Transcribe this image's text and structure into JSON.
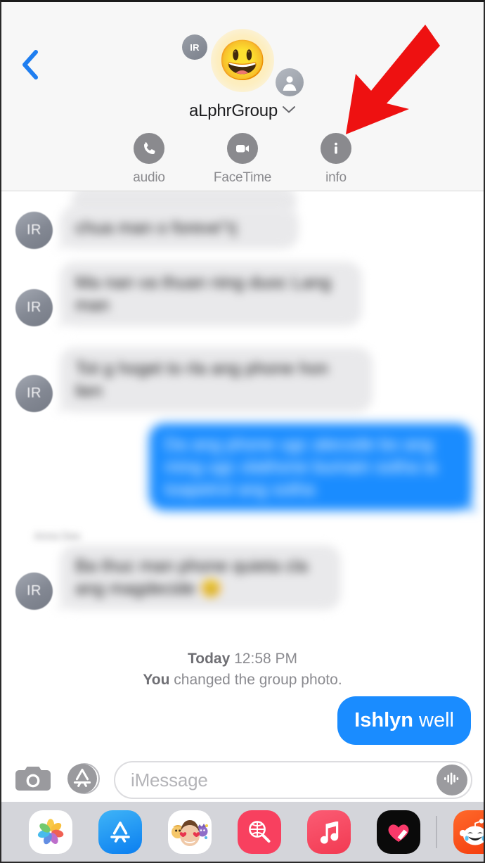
{
  "app": {
    "name": "Messages",
    "platform": "iOS"
  },
  "header": {
    "back_icon": "chevron-left-icon",
    "group_photo_emoji": "😃",
    "group_name": "aLphrGroup",
    "disclosure_icon": "chevron-down-icon",
    "participants": [
      {
        "initials": "IR",
        "type": "initials-avatar"
      },
      {
        "initials": "",
        "type": "person-placeholder-avatar"
      }
    ],
    "actions": [
      {
        "id": "audio",
        "label": "audio",
        "icon": "phone-icon"
      },
      {
        "id": "facetime",
        "label": "FaceTime",
        "icon": "video-camera-icon"
      },
      {
        "id": "info",
        "label": "info",
        "icon": "info-circle-icon"
      }
    ]
  },
  "annotation": {
    "type": "arrow",
    "color": "#ee1111",
    "points_to": "info"
  },
  "thread": {
    "messages": [
      {
        "id": "m0",
        "side": "received",
        "avatar_initials": "IR",
        "text": " ",
        "blurred": true,
        "partial": true
      },
      {
        "id": "m1",
        "side": "received",
        "avatar_initials": "IR",
        "text": "chua man o foreve\"rj",
        "blurred": true
      },
      {
        "id": "m2",
        "side": "received",
        "avatar_initials": "IR",
        "text": "Ma nan va thuan ning duoc Lang man",
        "blurred": true
      },
      {
        "id": "m3",
        "side": "received",
        "avatar_initials": "IR",
        "text": "Tot g hoget to rla ang phone hon lien",
        "blurred": true
      },
      {
        "id": "m4",
        "side": "sent",
        "text": "Da ang phone ugc alecode bo ang ming ugc olathone bumain sotha ia toapetrol ang sotha",
        "blurred": true
      },
      {
        "id": "m5",
        "side": "received",
        "sender_label": "Anna Dao",
        "avatar_initials": "IR",
        "text": "Ba thuc man phone quieta cla ang magdecide 😊",
        "blurred": true
      }
    ],
    "system_message": {
      "timestamp_day": "Today",
      "timestamp_time": "12:58 PM",
      "actor": "You",
      "text": " changed the group photo."
    },
    "last_sent_message": {
      "side": "sent",
      "name_part": "Ishlyn",
      "rest_part": " well",
      "full_text": "Ishlyn well"
    }
  },
  "composer": {
    "camera_icon": "camera-icon",
    "apps_icon": "app-store-icon",
    "placeholder": "iMessage",
    "value": "",
    "mic_icon": "audio-waveform-icon"
  },
  "dock": {
    "items": [
      {
        "id": "photos",
        "name": "photos-app-icon"
      },
      {
        "id": "app-store",
        "name": "app-store-app-icon"
      },
      {
        "id": "memoji",
        "name": "memoji-stickers-icon"
      },
      {
        "id": "images",
        "name": "images-gif-search-icon"
      },
      {
        "id": "music",
        "name": "apple-music-icon"
      },
      {
        "id": "digital-touch",
        "name": "digital-touch-heart-icon"
      },
      {
        "id": "reddit",
        "name": "reddit-app-icon"
      }
    ],
    "has_separator_before_last": true
  },
  "colors": {
    "imessage_blue": "#1a8cff",
    "received_gray": "#e9e9eb",
    "header_bg": "#f7f7f7",
    "dock_bg": "#d4d5da",
    "arrow_red": "#ee1111",
    "link_blue": "#1f7ef0"
  }
}
